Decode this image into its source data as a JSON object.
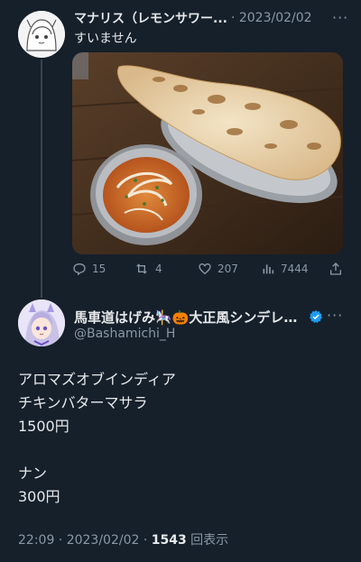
{
  "reply": {
    "display_name": "マナリス（レモンサワー...",
    "date": "· 2023/02/02",
    "text": "すいません",
    "actions": {
      "replies": "15",
      "retweets": "4",
      "likes": "207",
      "views": "7444"
    }
  },
  "main": {
    "display_name": "馬車道はげみ🎠🎃大正風シンデレラ...",
    "handle": "@Bashamichi_H",
    "lines": [
      "アロマズオブインディア",
      "チキンバターマサラ",
      "1500円",
      "",
      "ナン",
      "300円"
    ],
    "timestamp": "22:09 · 2023/02/02 · ",
    "view_count": "1543",
    "view_label": " 回表示"
  },
  "colors": {
    "background": "#15202b",
    "text": "#e7e9ea",
    "muted": "#8b98a5",
    "verified": "#1d9bf0"
  },
  "icons": [
    "reply-icon",
    "retweet-icon",
    "like-icon",
    "views-icon",
    "share-icon",
    "more-icon",
    "verified-badge-icon"
  ]
}
